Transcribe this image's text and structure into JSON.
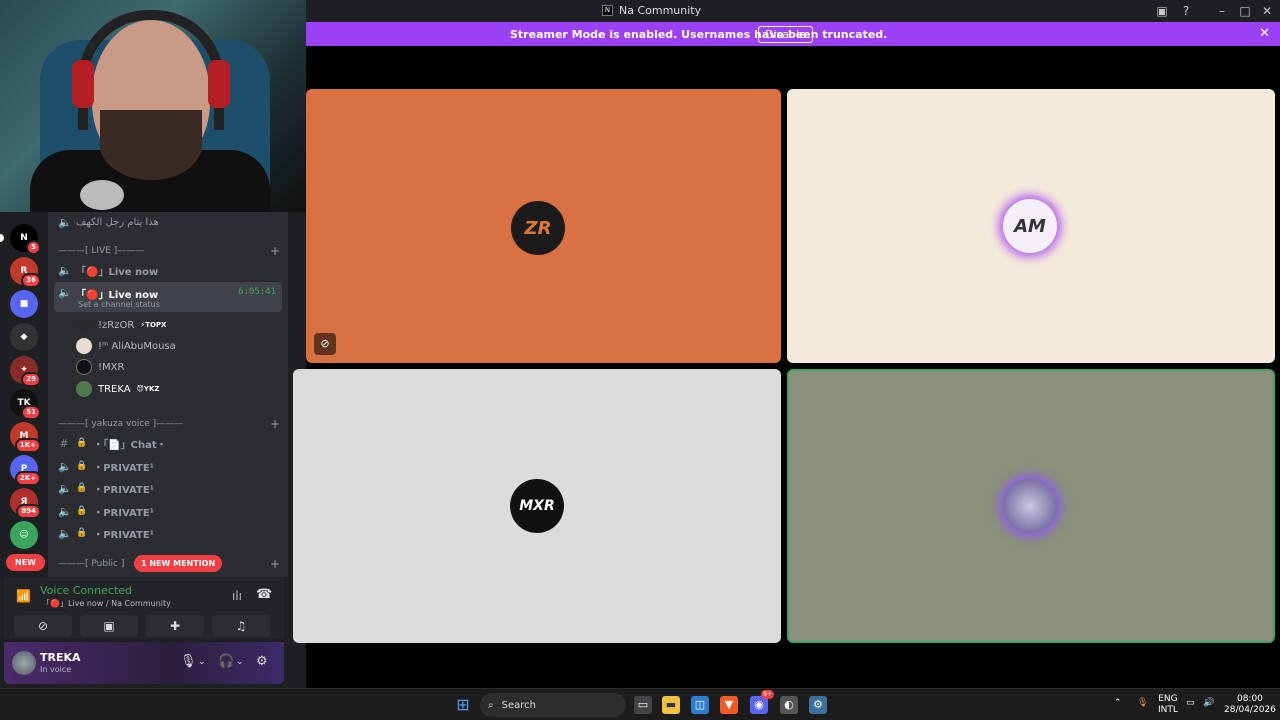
{
  "window": {
    "title": "Na Community",
    "logo_text": "N"
  },
  "titlebar_icons": [
    "screen-share-icon",
    "help-icon",
    "minimize-icon",
    "maximize-icon",
    "close-icon"
  ],
  "banner": {
    "message": "Streamer Mode is enabled. Usernames have been truncated.",
    "disable_label": "Disable",
    "color": "#9b40f5"
  },
  "servers": [
    {
      "name": "server-na-community",
      "glyph": "N",
      "badge": "5",
      "selected": true
    },
    {
      "name": "server-red",
      "glyph": "R",
      "badge": "36"
    },
    {
      "name": "server-folder",
      "glyph": "■"
    },
    {
      "name": "server-dark",
      "glyph": "◆"
    },
    {
      "name": "server-art",
      "glyph": "✦",
      "badge": "29"
    },
    {
      "name": "server-tk",
      "glyph": "TK",
      "badge": "51"
    },
    {
      "name": "server-m",
      "glyph": "M",
      "badge": "1K+"
    },
    {
      "name": "server-purple",
      "glyph": "P",
      "badge": "2K+"
    },
    {
      "name": "server-red2",
      "glyph": "Я",
      "badge": "894"
    },
    {
      "name": "server-green",
      "glyph": "☺"
    }
  ],
  "new_pill": "NEW",
  "channels": {
    "top_channel": "هذا يتام رجل الكهف",
    "category_live": "———[ LIVE ]———",
    "live_channel_1": "「🔴」Live now",
    "live_channel_2": "「🔴」Live now",
    "live_timer": "6:05:41",
    "set_status": "Set a channel status",
    "users": [
      {
        "name": "!zRzOR",
        "tag": "⚡TOPX",
        "avatar_color": "#2b2b2b"
      },
      {
        "name": "!ᵐ AliAbuMousa",
        "tag": "",
        "avatar_color": "#e8ddd0"
      },
      {
        "name": "!MXR",
        "tag": "",
        "avatar_color": "#111"
      },
      {
        "name": "TREKA",
        "tag": "😈YKZ",
        "avatar_color": "#4f7a4f"
      }
    ],
    "category_yakuza": "———[ yakuza voice ]———",
    "chat_channel": "・「📄」Chat・",
    "private_channels": [
      "・PRIVATE¹",
      "・PRIVATE¹",
      "・PRIVATE¹",
      "・PRIVATE¹"
    ],
    "category_public": "———[ Public ]",
    "mention_pill": "1 NEW MENTION"
  },
  "voice_panel": {
    "title": "Voice Connected",
    "subtitle": "「🔴」Live now / Na Community",
    "buttons": [
      "camera-off",
      "screen-share",
      "activities",
      "soundboard"
    ]
  },
  "user_panel": {
    "username": "TREKA",
    "status": "In voice"
  },
  "tiles": [
    {
      "name": "tile-zrzor",
      "bg": "#d97142",
      "avatar_text": "ZR",
      "avatar_bg": "#1b1b1b",
      "avatar_fg": "#e0772f"
    },
    {
      "name": "tile-aliabumousa",
      "bg": "#f4eadb",
      "avatar_text": "AM",
      "avatar_bg": "#f5f0f8",
      "avatar_fg": "#333"
    },
    {
      "name": "tile-mxr",
      "bg": "#dcdcdc",
      "avatar_text": "MXR",
      "avatar_bg": "#111",
      "avatar_fg": "#fff"
    },
    {
      "name": "tile-treka",
      "bg": "#8b917a",
      "avatar_text": "",
      "avatar_bg": "#6a5c8a",
      "avatar_fg": "#fff"
    }
  ],
  "taskbar": {
    "search_placeholder": "Search",
    "lang": "ENG",
    "layout": "INTL",
    "time": "08:00",
    "date": "28/04/2026",
    "discord_badge": "9+"
  }
}
